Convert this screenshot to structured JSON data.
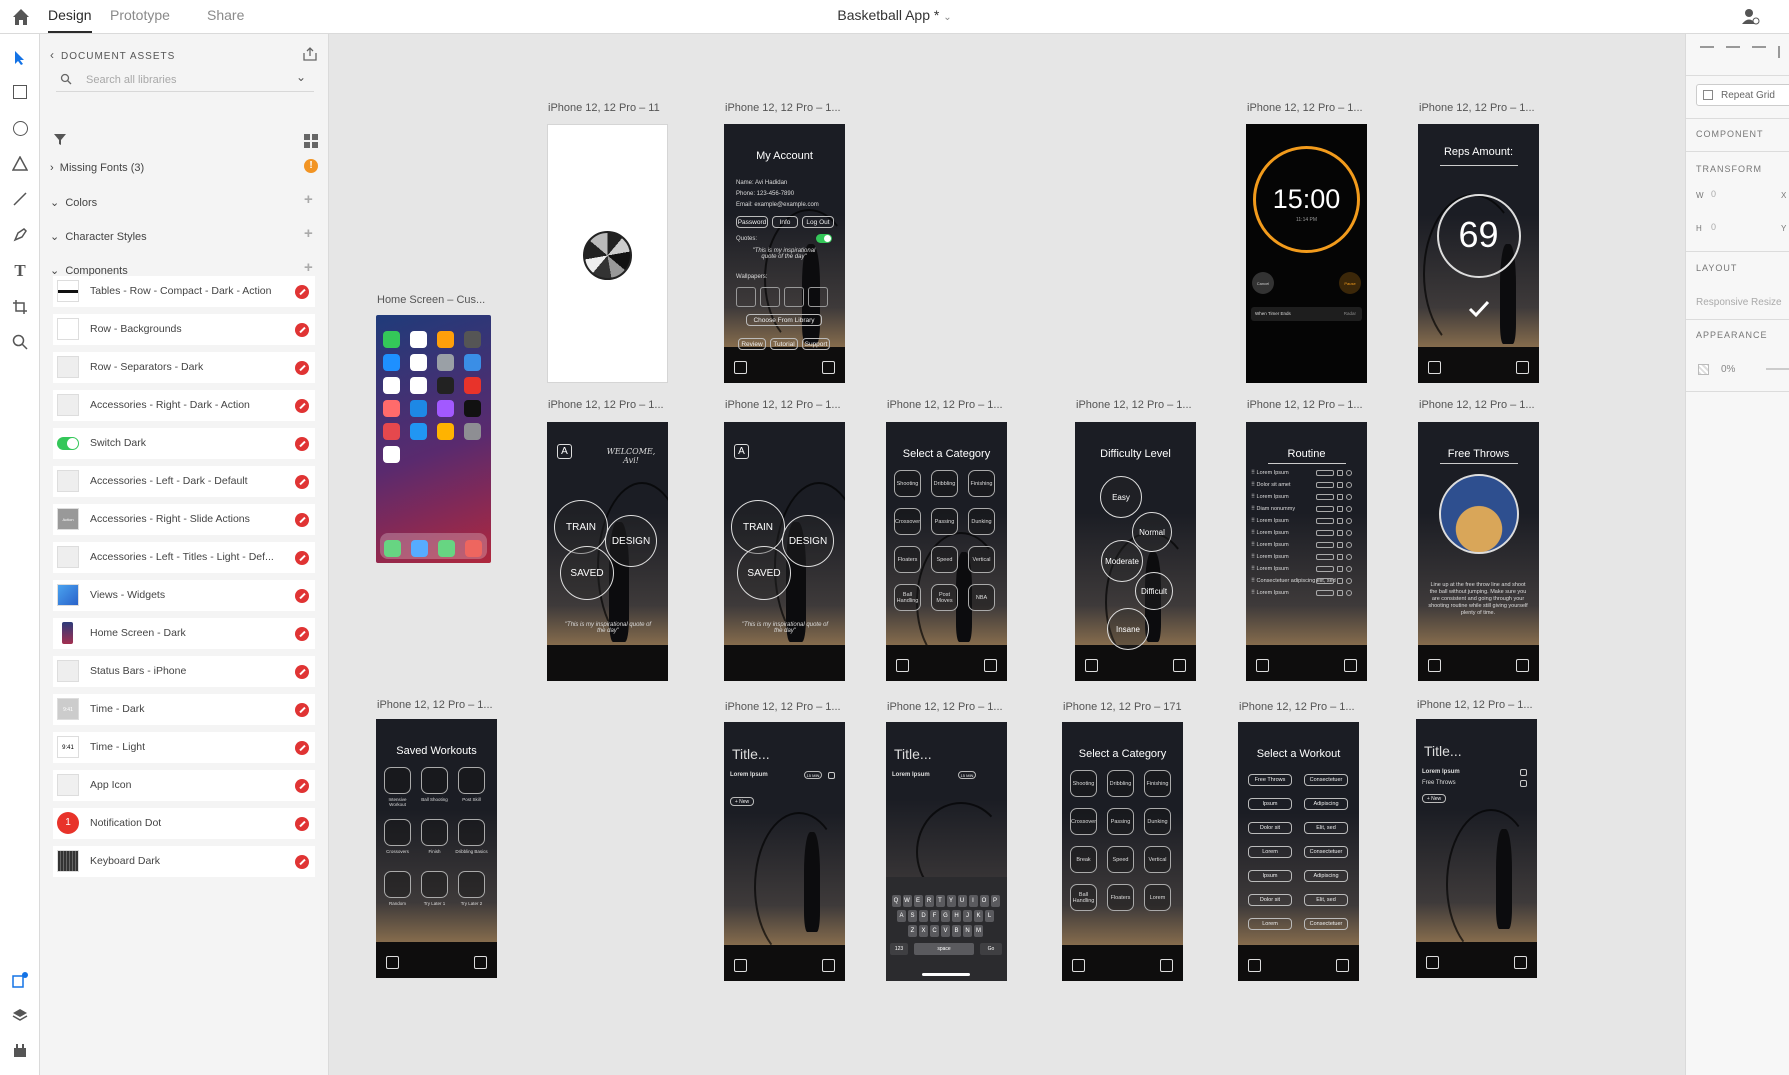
{
  "topbar": {
    "tabs": [
      "Design",
      "Prototype",
      "Share"
    ],
    "title": "Basketball App *"
  },
  "assets": {
    "header": "DOCUMENT ASSETS",
    "search_placeholder": "Search all libraries",
    "missing_fonts": "Missing Fonts (3)",
    "sections": [
      "Colors",
      "Character Styles",
      "Components"
    ],
    "components": [
      "Tables - Row - Compact - Dark - Action",
      "Row - Backgrounds",
      "Row - Separators - Dark",
      "Accessories - Right - Dark - Action",
      "Switch Dark",
      "Accessories - Left - Dark - Default",
      "Accessories - Right - Slide Actions",
      "Accessories - Left - Titles - Light - Def...",
      "Views - Widgets",
      "Home Screen - Dark",
      "Status Bars - iPhone",
      "Time - Dark",
      "Time - Light",
      "App Icon",
      "Notification Dot",
      "Keyboard Dark"
    ],
    "thumb_texts": {
      "time_dark": "9:41",
      "time_light": "9:41",
      "notification": "1",
      "slide": "Action"
    }
  },
  "canvas": {
    "labels": {
      "a1": "iPhone 12, 12 Pro – 11",
      "a2": "iPhone 12, 12 Pro – 1...",
      "a3": "iPhone 12, 12 Pro – 1...",
      "a4": "iPhone 12, 12 Pro – 1...",
      "home": "Home Screen – Cus...",
      "b1": "iPhone 12, 12 Pro – 1...",
      "b2": "iPhone 12, 12 Pro – 1...",
      "b3": "iPhone 12, 12 Pro – 1...",
      "b4": "iPhone 12, 12 Pro – 1...",
      "b5": "iPhone 12, 12 Pro – 1...",
      "b6": "iPhone 12, 12 Pro – 1...",
      "c1": "iPhone 12, 12 Pro – 1...",
      "c2": "iPhone 12, 12 Pro – 1...",
      "c3": "iPhone 12, 12 Pro – 1...",
      "c4": "iPhone 12, 12 Pro – 171",
      "c5": "iPhone 12, 12 Pro – 1...",
      "c6": "iPhone 12, 12 Pro – 1..."
    },
    "screens": {
      "my_account": {
        "title": "My Account",
        "name": "Name:  Avi Hadidan",
        "phone": "Phone:  123-456-7890",
        "email": "Email:  example@example.com",
        "buttons": [
          "Password",
          "Info",
          "Log Out"
        ],
        "quotes": "Quotes:",
        "quote_text": "\"This is my inspirational quote of the day\"",
        "wallpapers": "Wallpapers:",
        "choose": "Choose From Library",
        "footer": [
          "Review",
          "Tutorial",
          "Support"
        ]
      },
      "timer": {
        "time": "15:00",
        "sub": "11:14 PM",
        "cancel": "Cancel",
        "pause": "Pause",
        "ends": "When Timer Ends",
        "radar": "Radar"
      },
      "reps": {
        "title": "Reps Amount:",
        "value": "69"
      },
      "welcome": {
        "logo": "A",
        "greeting": "WELCOME, Avi!",
        "train": "TRAIN",
        "design": "DESIGN",
        "saved": "SAVED",
        "quote": "\"This is my inspirational quote of the day\""
      },
      "category": {
        "title": "Select a Category",
        "items": [
          "Shooting",
          "Dribbling",
          "Finishing",
          "Crossover",
          "Passing",
          "Dunking",
          "Floaters",
          "Speed",
          "Vertical",
          "Ball Handling",
          "Post Moves",
          "NBA"
        ]
      },
      "difficulty": {
        "title": "Difficulty Level",
        "levels": [
          "Easy",
          "Normal",
          "Moderate",
          "Difficult",
          "Insane"
        ]
      },
      "routine": {
        "title": "Routine",
        "items": [
          "Lorem Ipsum",
          "Dolor sit amet",
          "Lorem Ipsum",
          "Diam nonummy",
          "Lorem Ipsum",
          "Lorem Ipsum",
          "Lorem Ipsum",
          "Lorem Ipsum",
          "Lorem Ipsum",
          "Consectetuer adipiscing elit, sed",
          "Lorem Ipsum"
        ]
      },
      "free_throws": {
        "title": "Free Throws",
        "desc": "Line up at the free throw line and shoot the ball without jumping. Make sure you are consistent and going through your shooting routine while still giving yourself plenty of time."
      },
      "saved_workouts": {
        "title": "Saved Workouts",
        "items": [
          "Intensive Workout",
          "Ball Shooting",
          "Post Skill",
          "Crossovers",
          "Finish",
          "Dribbling Basics",
          "Random",
          "Try Later 1",
          "Try Later 2"
        ]
      },
      "title_screen": {
        "title": "Title...",
        "item": "Lorem Ipsum",
        "badge": "15 MIN",
        "new": "+ New"
      },
      "title_kb": {
        "title": "Title...",
        "item": "Lorem Ipsum",
        "badge": "15 MIN",
        "keys_r1": "QWERTYUIOP",
        "keys_r2": "ASDFGHJKL",
        "keys_r3": "ZXCVBNM",
        "num": "123",
        "space": "space",
        "go": "Go"
      },
      "category2": {
        "title": "Select a Category",
        "items": [
          "Shooting",
          "Dribbling",
          "Finishing",
          "Crossover",
          "Passing",
          "Dunking",
          "Break",
          "Speed",
          "Vertical",
          "Ball Handling",
          "Floaters",
          "Lorem"
        ]
      },
      "workout": {
        "title": "Select a Workout",
        "items": [
          "Free Throws",
          "Consectetuer",
          "Ipsum",
          "Adipiscing",
          "Dolor sit",
          "Elit, sed",
          "Lorem",
          "Consectetuer",
          "Ipsum",
          "Adipiscing",
          "Dolor sit",
          "Elit, sed",
          "Lorem",
          "Consectetuer"
        ]
      },
      "title_screen2": {
        "title": "Title...",
        "item1": "Lorem Ipsum",
        "item2": "Free Throws",
        "new": "+ New"
      }
    }
  },
  "props": {
    "repeat_grid": "Repeat Grid",
    "component": "COMPONENT",
    "transform": "TRANSFORM",
    "w_label": "W",
    "w_val": "0",
    "x_label": "X",
    "h_label": "H",
    "h_val": "0",
    "y_label": "Y",
    "layout": "LAYOUT",
    "responsive": "Responsive Resize",
    "appearance": "APPEARANCE",
    "opacity": "0%"
  },
  "colors": {
    "accent": "#1473e6",
    "warning": "#f29423",
    "link_red": "#e03434",
    "timer_ring": "#f29b1c"
  }
}
